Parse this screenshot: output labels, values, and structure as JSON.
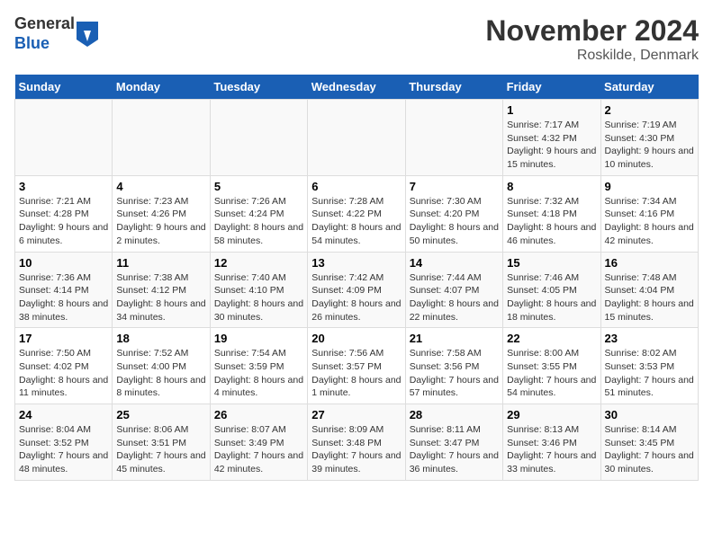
{
  "header": {
    "logo_line1": "General",
    "logo_line2": "Blue",
    "month_year": "November 2024",
    "location": "Roskilde, Denmark"
  },
  "days_of_week": [
    "Sunday",
    "Monday",
    "Tuesday",
    "Wednesday",
    "Thursday",
    "Friday",
    "Saturday"
  ],
  "weeks": [
    [
      {
        "num": "",
        "info": ""
      },
      {
        "num": "",
        "info": ""
      },
      {
        "num": "",
        "info": ""
      },
      {
        "num": "",
        "info": ""
      },
      {
        "num": "",
        "info": ""
      },
      {
        "num": "1",
        "info": "Sunrise: 7:17 AM\nSunset: 4:32 PM\nDaylight: 9 hours and 15 minutes."
      },
      {
        "num": "2",
        "info": "Sunrise: 7:19 AM\nSunset: 4:30 PM\nDaylight: 9 hours and 10 minutes."
      }
    ],
    [
      {
        "num": "3",
        "info": "Sunrise: 7:21 AM\nSunset: 4:28 PM\nDaylight: 9 hours and 6 minutes."
      },
      {
        "num": "4",
        "info": "Sunrise: 7:23 AM\nSunset: 4:26 PM\nDaylight: 9 hours and 2 minutes."
      },
      {
        "num": "5",
        "info": "Sunrise: 7:26 AM\nSunset: 4:24 PM\nDaylight: 8 hours and 58 minutes."
      },
      {
        "num": "6",
        "info": "Sunrise: 7:28 AM\nSunset: 4:22 PM\nDaylight: 8 hours and 54 minutes."
      },
      {
        "num": "7",
        "info": "Sunrise: 7:30 AM\nSunset: 4:20 PM\nDaylight: 8 hours and 50 minutes."
      },
      {
        "num": "8",
        "info": "Sunrise: 7:32 AM\nSunset: 4:18 PM\nDaylight: 8 hours and 46 minutes."
      },
      {
        "num": "9",
        "info": "Sunrise: 7:34 AM\nSunset: 4:16 PM\nDaylight: 8 hours and 42 minutes."
      }
    ],
    [
      {
        "num": "10",
        "info": "Sunrise: 7:36 AM\nSunset: 4:14 PM\nDaylight: 8 hours and 38 minutes."
      },
      {
        "num": "11",
        "info": "Sunrise: 7:38 AM\nSunset: 4:12 PM\nDaylight: 8 hours and 34 minutes."
      },
      {
        "num": "12",
        "info": "Sunrise: 7:40 AM\nSunset: 4:10 PM\nDaylight: 8 hours and 30 minutes."
      },
      {
        "num": "13",
        "info": "Sunrise: 7:42 AM\nSunset: 4:09 PM\nDaylight: 8 hours and 26 minutes."
      },
      {
        "num": "14",
        "info": "Sunrise: 7:44 AM\nSunset: 4:07 PM\nDaylight: 8 hours and 22 minutes."
      },
      {
        "num": "15",
        "info": "Sunrise: 7:46 AM\nSunset: 4:05 PM\nDaylight: 8 hours and 18 minutes."
      },
      {
        "num": "16",
        "info": "Sunrise: 7:48 AM\nSunset: 4:04 PM\nDaylight: 8 hours and 15 minutes."
      }
    ],
    [
      {
        "num": "17",
        "info": "Sunrise: 7:50 AM\nSunset: 4:02 PM\nDaylight: 8 hours and 11 minutes."
      },
      {
        "num": "18",
        "info": "Sunrise: 7:52 AM\nSunset: 4:00 PM\nDaylight: 8 hours and 8 minutes."
      },
      {
        "num": "19",
        "info": "Sunrise: 7:54 AM\nSunset: 3:59 PM\nDaylight: 8 hours and 4 minutes."
      },
      {
        "num": "20",
        "info": "Sunrise: 7:56 AM\nSunset: 3:57 PM\nDaylight: 8 hours and 1 minute."
      },
      {
        "num": "21",
        "info": "Sunrise: 7:58 AM\nSunset: 3:56 PM\nDaylight: 7 hours and 57 minutes."
      },
      {
        "num": "22",
        "info": "Sunrise: 8:00 AM\nSunset: 3:55 PM\nDaylight: 7 hours and 54 minutes."
      },
      {
        "num": "23",
        "info": "Sunrise: 8:02 AM\nSunset: 3:53 PM\nDaylight: 7 hours and 51 minutes."
      }
    ],
    [
      {
        "num": "24",
        "info": "Sunrise: 8:04 AM\nSunset: 3:52 PM\nDaylight: 7 hours and 48 minutes."
      },
      {
        "num": "25",
        "info": "Sunrise: 8:06 AM\nSunset: 3:51 PM\nDaylight: 7 hours and 45 minutes."
      },
      {
        "num": "26",
        "info": "Sunrise: 8:07 AM\nSunset: 3:49 PM\nDaylight: 7 hours and 42 minutes."
      },
      {
        "num": "27",
        "info": "Sunrise: 8:09 AM\nSunset: 3:48 PM\nDaylight: 7 hours and 39 minutes."
      },
      {
        "num": "28",
        "info": "Sunrise: 8:11 AM\nSunset: 3:47 PM\nDaylight: 7 hours and 36 minutes."
      },
      {
        "num": "29",
        "info": "Sunrise: 8:13 AM\nSunset: 3:46 PM\nDaylight: 7 hours and 33 minutes."
      },
      {
        "num": "30",
        "info": "Sunrise: 8:14 AM\nSunset: 3:45 PM\nDaylight: 7 hours and 30 minutes."
      }
    ]
  ]
}
